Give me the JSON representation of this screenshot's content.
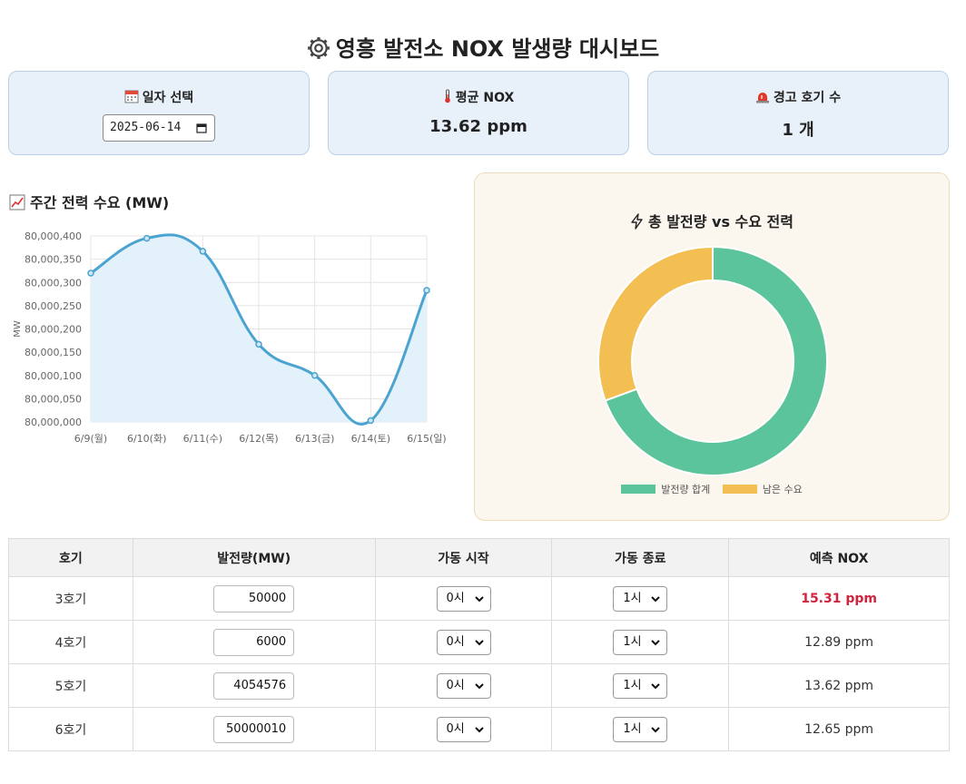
{
  "title": "영흥 발전소 NOX 발생량 대시보드",
  "cards": {
    "date": {
      "label": "일자 선택",
      "value": "2025-06-14"
    },
    "avg_nox": {
      "label": "평균 NOX",
      "value": "13.62 ppm"
    },
    "warning": {
      "label": "경고 호기 수",
      "value": "1 개"
    }
  },
  "line_chart": {
    "title": "주간 전력 수요 (MW)"
  },
  "donut_chart": {
    "title": "총 발전량 vs 수요 전력"
  },
  "chart_data": [
    {
      "type": "line",
      "title": "주간 전력 수요 (MW)",
      "ylabel": "MW",
      "categories": [
        "6/9(월)",
        "6/10(화)",
        "6/11(수)",
        "6/12(목)",
        "6/13(금)",
        "6/14(토)",
        "6/15(일)"
      ],
      "values": [
        80000320,
        80000395,
        80000367,
        80000167,
        80000100,
        80000003,
        80000283
      ],
      "ylim": [
        80000000,
        80000400
      ],
      "yticks": [
        "80,000,400",
        "80,000,350",
        "80,000,300",
        "80,000,250",
        "80,000,200",
        "80,000,150",
        "80,000,100",
        "80,000,050",
        "80,000,000"
      ],
      "grid": true,
      "color": "#4aa3d0",
      "fill": "#e3f2fa"
    },
    {
      "type": "pie",
      "title": "총 발전량 vs 수요 전력",
      "labels": [
        "발전량 합계",
        "남은 수요"
      ],
      "values": [
        69.4,
        30.6
      ],
      "colors": [
        "#5bc49a",
        "#f3be52"
      ],
      "legend": "bottom"
    }
  ],
  "table": {
    "headers": [
      "호기",
      "발전량(MW)",
      "가동 시작",
      "가동 종료",
      "예측 NOX"
    ],
    "rows": [
      {
        "unit": "3호기",
        "power": "50000",
        "start": "0시",
        "end": "1시",
        "nox": "15.31 ppm",
        "warn": true
      },
      {
        "unit": "4호기",
        "power": "6000",
        "start": "0시",
        "end": "1시",
        "nox": "12.89 ppm",
        "warn": false
      },
      {
        "unit": "5호기",
        "power": "4054576",
        "start": "0시",
        "end": "1시",
        "nox": "13.62 ppm",
        "warn": false
      },
      {
        "unit": "6호기",
        "power": "50000010",
        "start": "0시",
        "end": "1시",
        "nox": "12.65 ppm",
        "warn": false
      }
    ]
  }
}
